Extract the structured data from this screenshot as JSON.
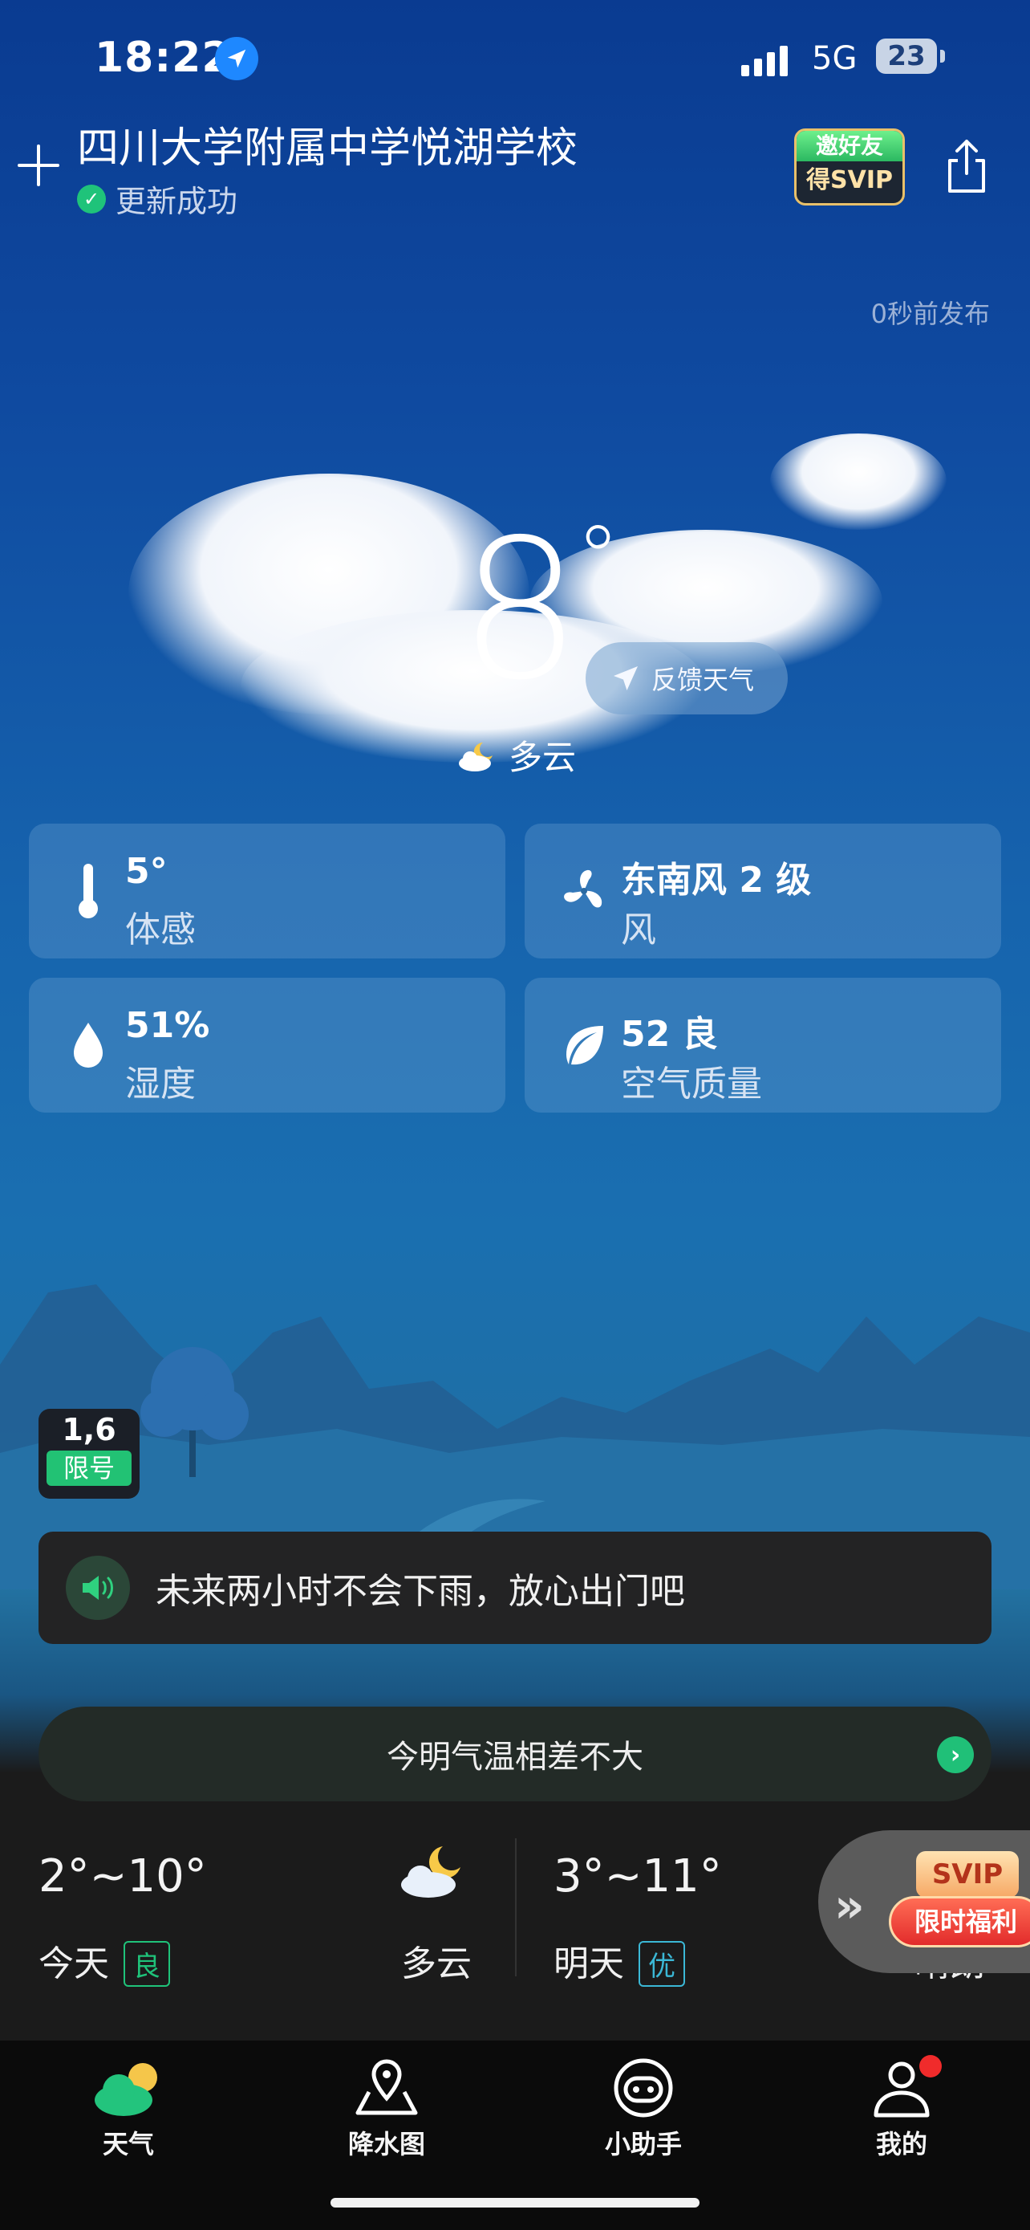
{
  "status_bar": {
    "time": "18:22",
    "network": "5G",
    "battery": "23"
  },
  "header": {
    "location": "四川大学附属中学悦湖学校",
    "update_status": "更新成功",
    "invite_top": "邀好友",
    "invite_bottom": "得SVIP"
  },
  "publish_time": "0秒前发布",
  "current": {
    "temperature": "8",
    "degree_symbol": "°",
    "feedback_label": "反馈天气",
    "condition": "多云"
  },
  "details": [
    {
      "value": "5°",
      "label": "体感",
      "icon": "thermometer-icon"
    },
    {
      "value": "东南风 2 级",
      "label": "风",
      "icon": "wind-fan-icon"
    },
    {
      "value": "51%",
      "label": "湿度",
      "icon": "water-drop-icon"
    },
    {
      "value": "52 良",
      "label": "空气质量",
      "icon": "leaf-icon"
    }
  ],
  "traffic_limit": {
    "numbers": "1,6",
    "label": "限号"
  },
  "rain_notice": "未来两小时不会下雨，放心出门吧",
  "temp_diff": "今明气温相差不大",
  "forecast": [
    {
      "day": "今天",
      "range": "2°~10°",
      "aqi": "良",
      "condition": "多云",
      "aqi_color": "#1fc37a"
    },
    {
      "day": "明天",
      "range": "3°~11°",
      "aqi": "优",
      "condition": "晴朗",
      "aqi_color": "#3bb8d6"
    }
  ],
  "promo": {
    "top": "SVIP",
    "bottom": "限时福利"
  },
  "tabs": [
    {
      "label": "天气",
      "icon": "weather-icon"
    },
    {
      "label": "降水图",
      "icon": "map-pin-icon"
    },
    {
      "label": "小助手",
      "icon": "assistant-icon"
    },
    {
      "label": "我的",
      "icon": "profile-icon"
    }
  ]
}
